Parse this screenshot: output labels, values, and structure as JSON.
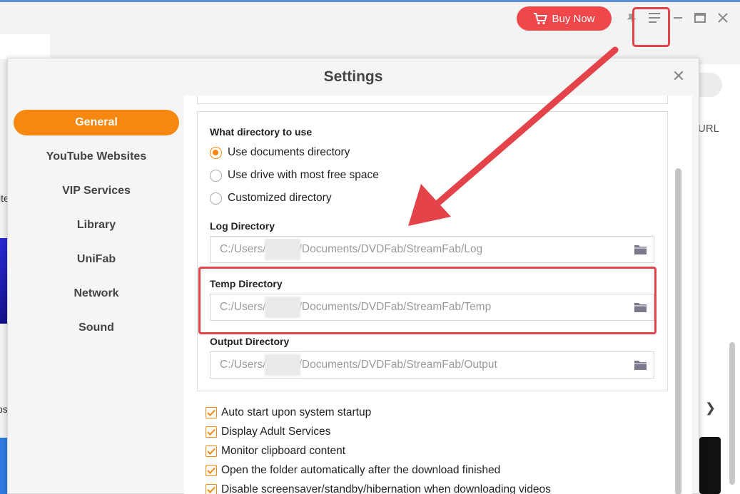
{
  "app": {
    "buy_label": "Buy Now",
    "bg_url_fragment": "URL",
    "bg_left_text1": "ite",
    "bg_left_text2": "os"
  },
  "dialog": {
    "title": "Settings",
    "close_glyph": "✕"
  },
  "sidebar": {
    "items": [
      {
        "label": "General",
        "active": true
      },
      {
        "label": "YouTube Websites"
      },
      {
        "label": "VIP Services"
      },
      {
        "label": "Library"
      },
      {
        "label": "UniFab"
      },
      {
        "label": "Network"
      },
      {
        "label": "Sound"
      }
    ]
  },
  "directory": {
    "title": "What directory to use",
    "options": [
      {
        "label": "Use documents directory",
        "checked": true
      },
      {
        "label": "Use drive with most free space",
        "checked": false
      },
      {
        "label": "Customized directory",
        "checked": false
      }
    ],
    "log": {
      "label": "Log Directory",
      "prefix": "C:/Users/",
      "suffix": "/Documents/DVDFab/StreamFab/Log"
    },
    "temp": {
      "label": "Temp Directory",
      "prefix": "C:/Users/",
      "suffix": "/Documents/DVDFab/StreamFab/Temp"
    },
    "output": {
      "label": "Output Directory",
      "prefix": "C:/Users/",
      "suffix": "/Documents/DVDFab/StreamFab/Output"
    }
  },
  "options": {
    "auto_start": "Auto start upon system startup",
    "adult": "Display Adult Services",
    "clipboard": "Monitor clipboard content",
    "open_folder": "Open the folder automatically after the download finished",
    "screensaver": "Disable screensaver/standby/hibernation when downloading videos"
  },
  "colors": {
    "accent": "#f7880f",
    "highlight": "#e4434a",
    "buy": "#f0474a"
  }
}
